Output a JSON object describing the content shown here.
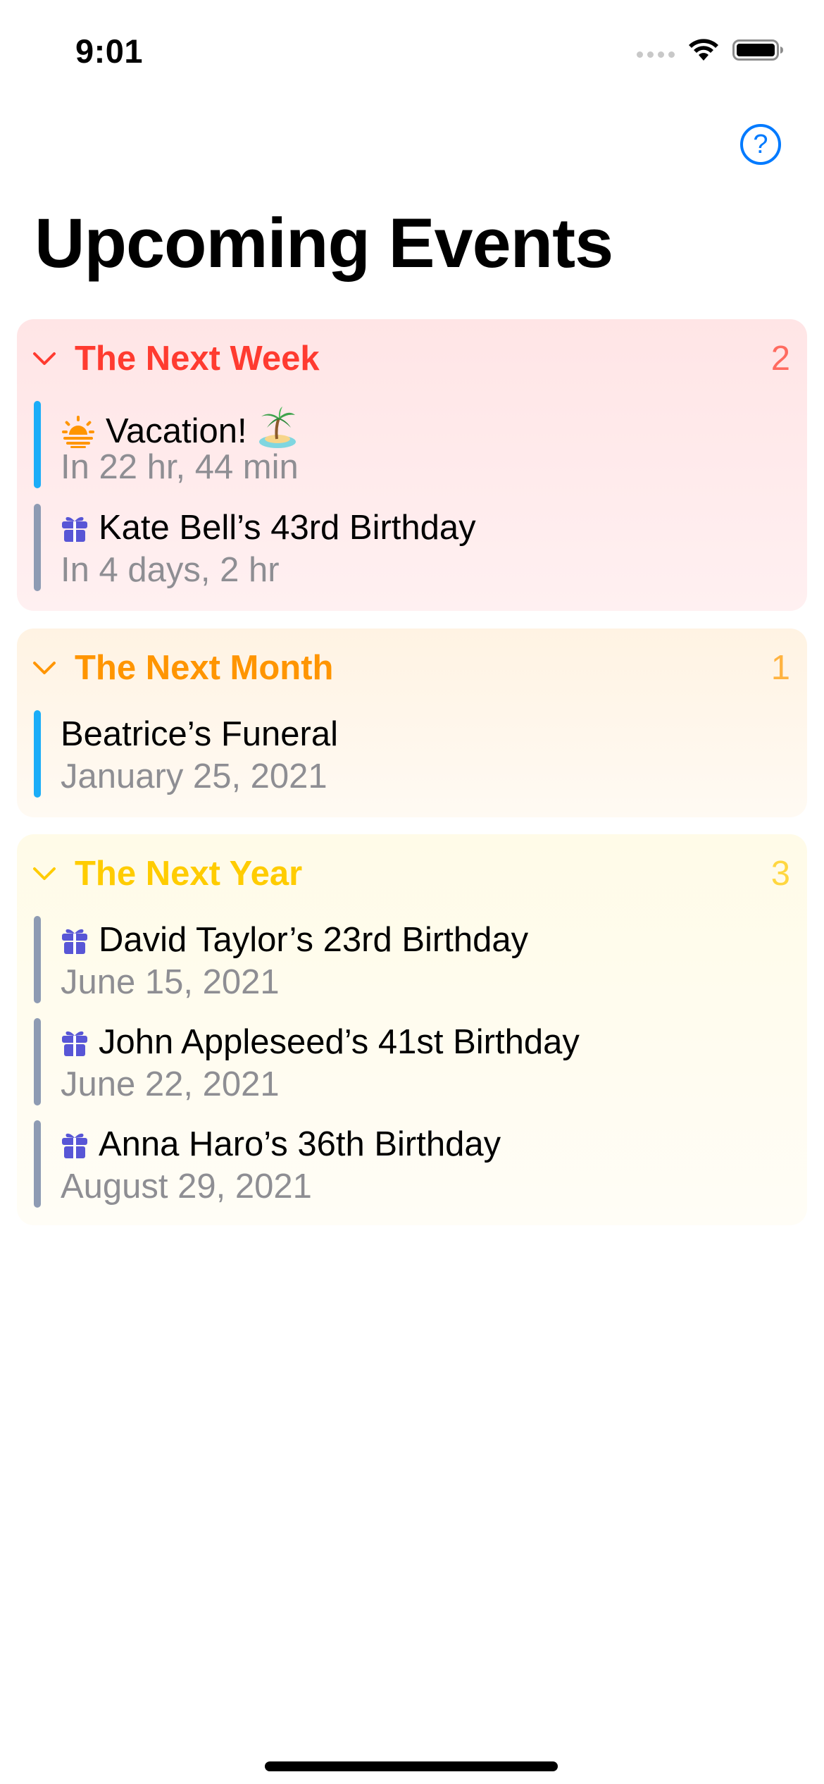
{
  "status_bar": {
    "time": "9:01"
  },
  "help_button": {
    "label": "?"
  },
  "page_title": "Upcoming Events",
  "sections": [
    {
      "title": "The Next Week",
      "count": "2",
      "color": "#ff3b30",
      "count_color": "#ff6b60",
      "events": [
        {
          "icon": "sunrise-icon",
          "title": "Vacation!",
          "trailing_icon": "palm-island-icon",
          "subtitle": "In 22 hr, 44 min",
          "bar_color": "#1badf8"
        },
        {
          "icon": "gift-icon",
          "title": "Kate Bell’s 43rd Birthday",
          "subtitle": "In 4 days, 2 hr",
          "bar_color": "#8e9bb3"
        }
      ]
    },
    {
      "title": "The Next Month",
      "count": "1",
      "color": "#ff9500",
      "count_color": "#ffb340",
      "events": [
        {
          "icon": "",
          "title": "Beatrice’s Funeral",
          "subtitle": "January 25, 2021",
          "bar_color": "#1badf8"
        }
      ]
    },
    {
      "title": "The Next Year",
      "count": "3",
      "color": "#ffcc00",
      "count_color": "#ffd740",
      "events": [
        {
          "icon": "gift-icon",
          "title": "David Taylor’s 23rd Birthday",
          "subtitle": "June 15, 2021",
          "bar_color": "#8e9bb3"
        },
        {
          "icon": "gift-icon",
          "title": "John Appleseed’s 41st Birthday",
          "subtitle": "June 22, 2021",
          "bar_color": "#8e9bb3"
        },
        {
          "icon": "gift-icon",
          "title": "Anna Haro’s 36th Birthday",
          "subtitle": "August 29, 2021",
          "bar_color": "#8e9bb3"
        }
      ]
    }
  ],
  "colors": {
    "accent": "#007aff",
    "gift_icon": "#5856d6",
    "subtitle": "#8e8e93"
  }
}
